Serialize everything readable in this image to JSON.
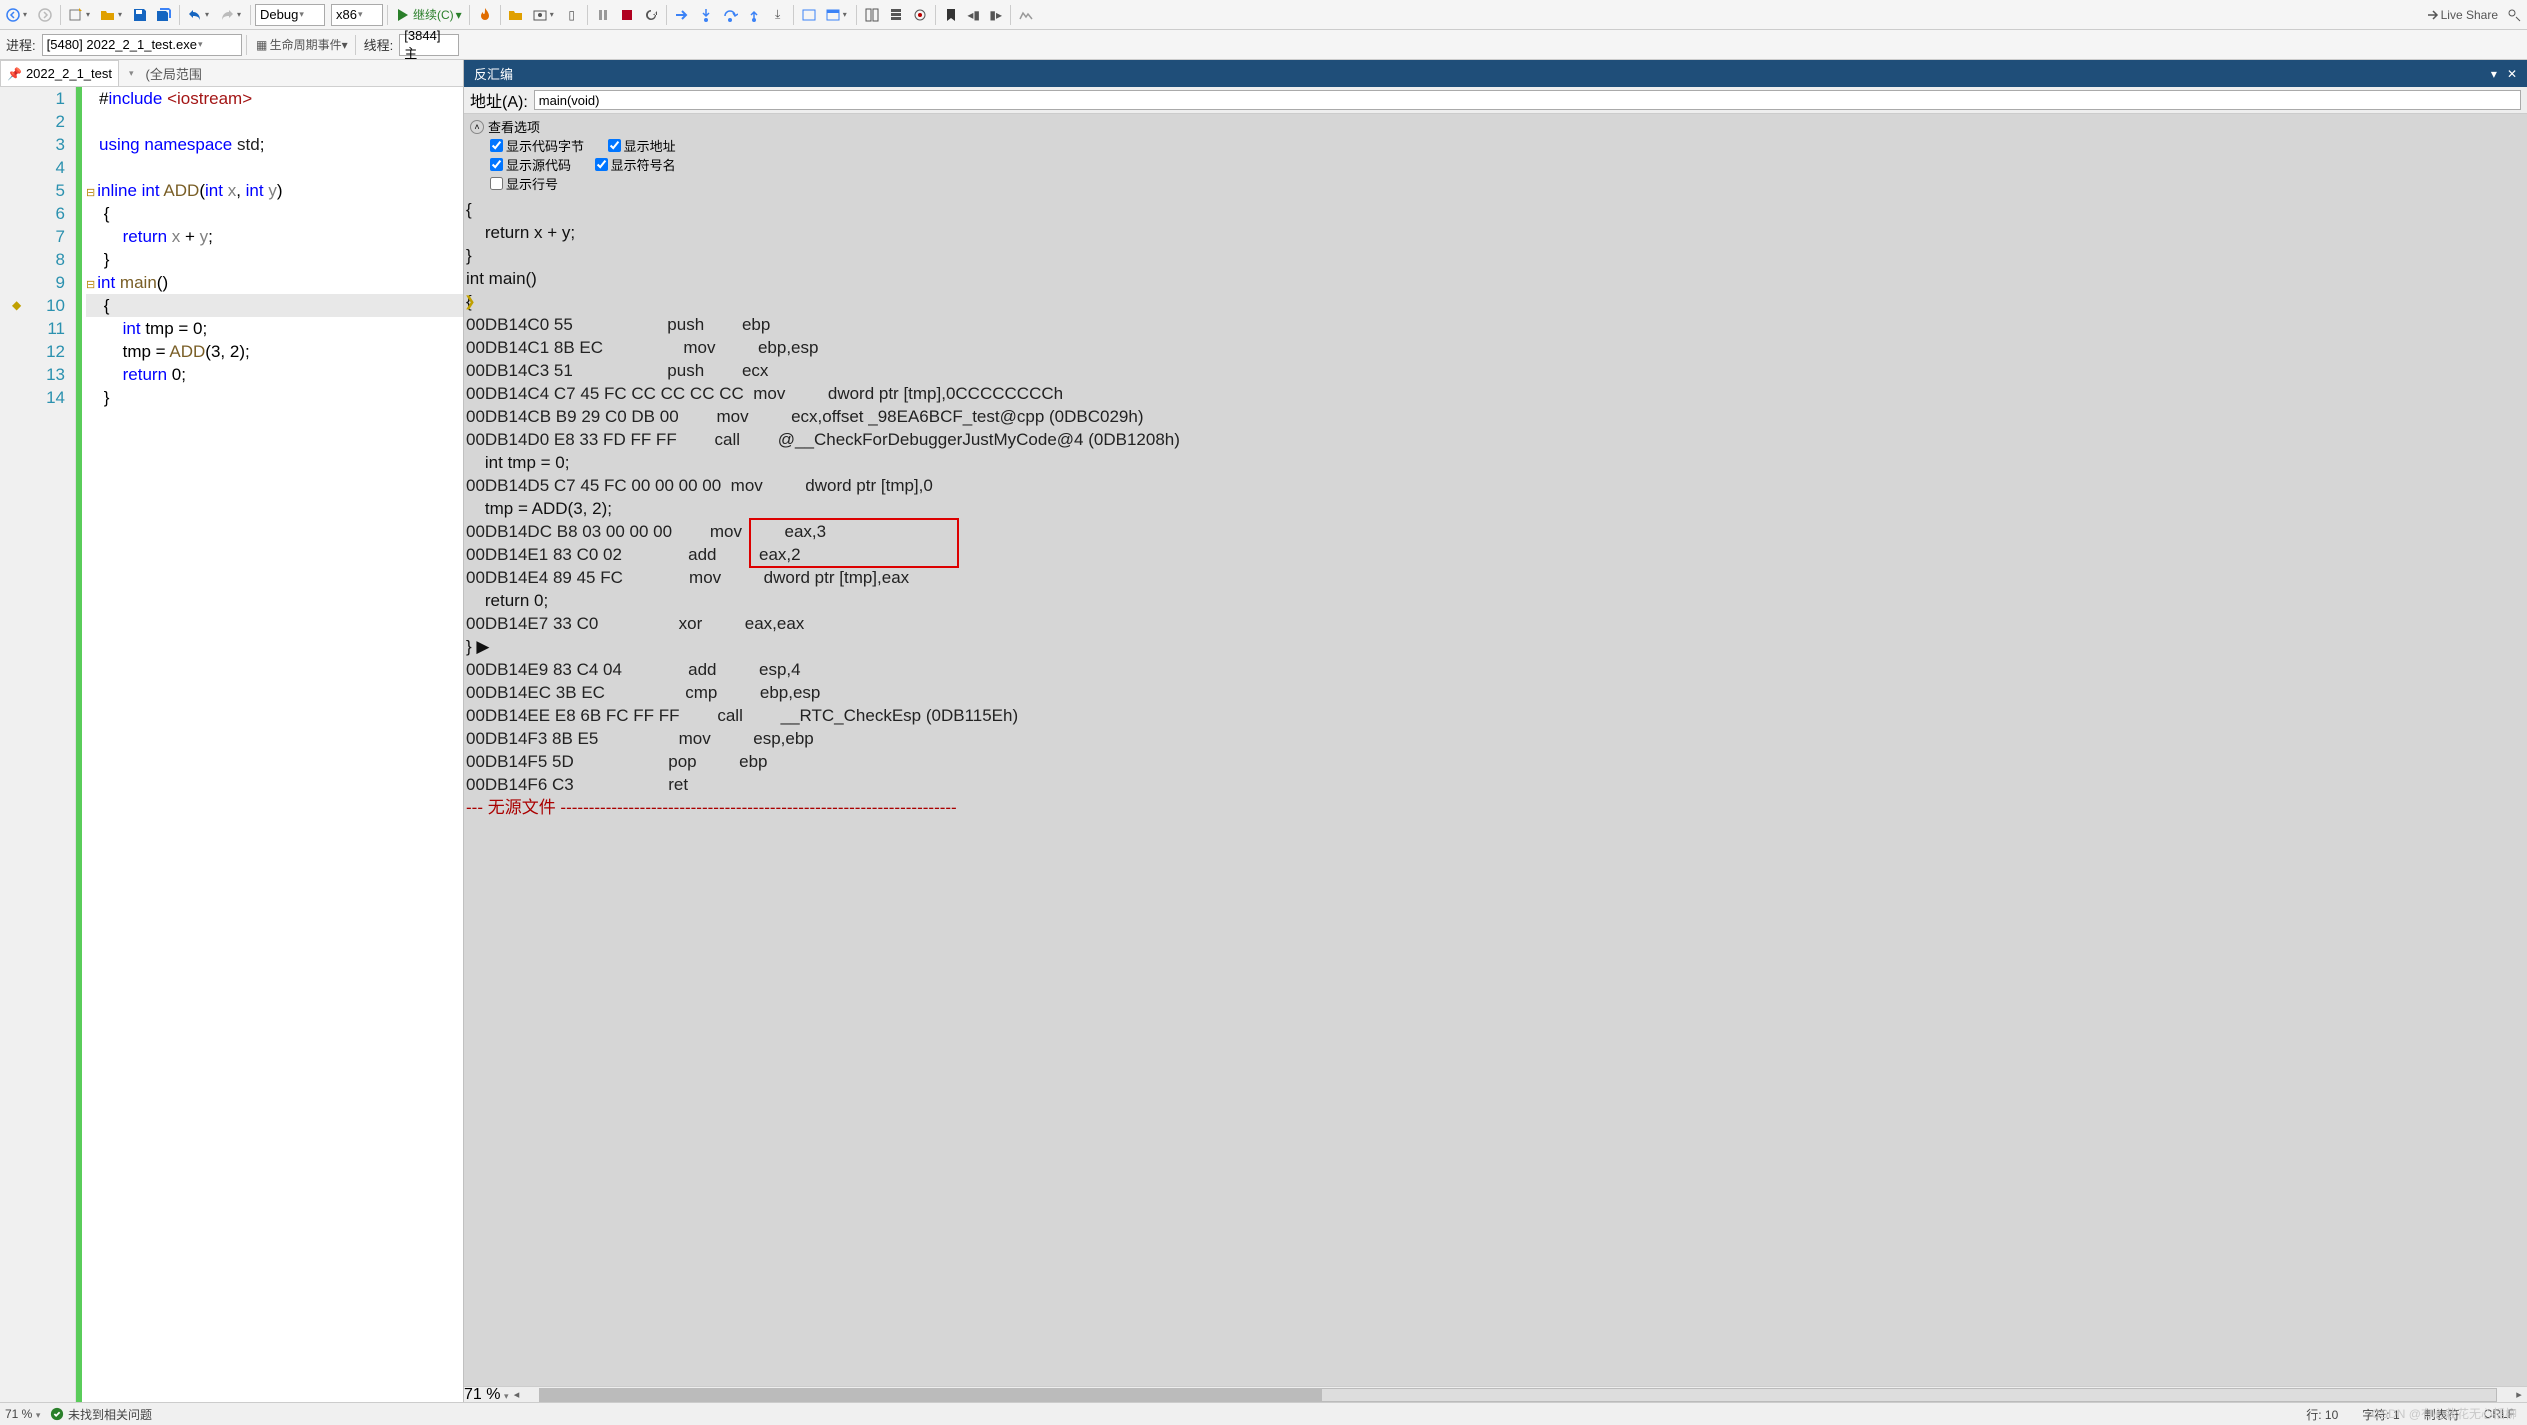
{
  "toolbar1": {
    "config": "Debug",
    "platform": "x86",
    "continue_label": "继续(C)",
    "live_share": "Live Share"
  },
  "toolbar2": {
    "process_label": "进程:",
    "process_value": "[5480] 2022_2_1_test.exe",
    "lifecycle_label": "生命周期事件",
    "thread_label": "线程:",
    "thread_value": "[3844] 主"
  },
  "left_pane": {
    "tab_name": "2022_2_1_test",
    "scope": "(全局范围",
    "lines": [
      "1",
      "2",
      "3",
      "4",
      "5",
      "6",
      "7",
      "8",
      "9",
      "10",
      "11",
      "12",
      "13",
      "14"
    ],
    "code": [
      {
        "html": "#<span class='t-kw'>include</span> <span class='t-inc'>&lt;iostream&gt;</span>",
        "o": ""
      },
      {
        "html": "",
        "o": ""
      },
      {
        "html": "<span class='t-kw'>using</span> <span class='t-kw'>namespace</span> <span class='t-id'>std</span>;",
        "o": ""
      },
      {
        "html": "",
        "o": ""
      },
      {
        "html": "<span class='t-kw'>inline</span> <span class='t-ty'>int</span> <span class='t-fn'>ADD</span>(<span class='t-ty'>int</span> <span class='t-pp'>x</span>, <span class='t-ty'>int</span> <span class='t-pp'>y</span>)",
        "o": "⊟"
      },
      {
        "html": " {",
        "o": ""
      },
      {
        "html": "     <span class='t-kw'>return</span> <span class='t-pp'>x</span> + <span class='t-pp'>y</span>;",
        "o": ""
      },
      {
        "html": " }",
        "o": ""
      },
      {
        "html": "<span class='t-ty'>int</span> <span class='t-fn'>main</span>()",
        "o": "⊟"
      },
      {
        "html": " {",
        "o": "",
        "hl": true,
        "bp": true
      },
      {
        "html": "     <span class='t-ty'>int</span> tmp = 0;",
        "o": ""
      },
      {
        "html": "     tmp = <span class='t-fn'>ADD</span>(3, 2);",
        "o": ""
      },
      {
        "html": "     <span class='t-kw'>return</span> 0;",
        "o": ""
      },
      {
        "html": " }",
        "o": ""
      }
    ]
  },
  "right_pane": {
    "title": "反汇编",
    "addr_label": "地址(A):",
    "addr_value": "main(void)",
    "view_options": "查看选项",
    "cb_code_bytes": "显示代码字节",
    "cb_show_addr": "显示地址",
    "cb_show_src": "显示源代码",
    "cb_symbol": "显示符号名",
    "cb_line_no": "显示行号",
    "rows": [
      {
        "t": "src",
        "s": "{"
      },
      {
        "t": "src",
        "s": "    return x + y;"
      },
      {
        "t": "src",
        "s": "}"
      },
      {
        "t": "src",
        "s": "int main()"
      },
      {
        "t": "src",
        "s": "{",
        "ptr": true
      },
      {
        "t": "asm",
        "a": "00DB14C0",
        "b": "55",
        "m": "push",
        "o": "ebp"
      },
      {
        "t": "asm",
        "a": "00DB14C1",
        "b": "8B EC",
        "m": "mov",
        "o": "ebp,esp"
      },
      {
        "t": "asm",
        "a": "00DB14C3",
        "b": "51",
        "m": "push",
        "o": "ecx"
      },
      {
        "t": "asm",
        "a": "00DB14C4",
        "b": "C7 45 FC CC CC CC CC",
        "m": "mov",
        "o": "dword ptr [tmp],0CCCCCCCCh"
      },
      {
        "t": "asm",
        "a": "00DB14CB",
        "b": "B9 29 C0 DB 00",
        "m": "mov",
        "o": "ecx,offset _98EA6BCF_test@cpp (0DBC029h)"
      },
      {
        "t": "asm",
        "a": "00DB14D0",
        "b": "E8 33 FD FF FF",
        "m": "call",
        "o": "@__CheckForDebuggerJustMyCode@4 (0DB1208h)"
      },
      {
        "t": "src",
        "s": "    int tmp = 0;"
      },
      {
        "t": "asm",
        "a": "00DB14D5",
        "b": "C7 45 FC 00 00 00 00",
        "m": "mov",
        "o": "dword ptr [tmp],0"
      },
      {
        "t": "src",
        "s": "    tmp = ADD(3, 2);"
      },
      {
        "t": "asm",
        "a": "00DB14DC",
        "b": "B8 03 00 00 00",
        "m": "mov",
        "o": "eax,3"
      },
      {
        "t": "asm",
        "a": "00DB14E1",
        "b": "83 C0 02",
        "m": "add",
        "o": "eax,2"
      },
      {
        "t": "asm",
        "a": "00DB14E4",
        "b": "89 45 FC",
        "m": "mov",
        "o": "dword ptr [tmp],eax"
      },
      {
        "t": "src",
        "s": "    return 0;"
      },
      {
        "t": "asm",
        "a": "00DB14E7",
        "b": "33 C0",
        "m": "xor",
        "o": "eax,eax"
      },
      {
        "t": "src",
        "s": "} ▶"
      },
      {
        "t": "asm",
        "a": "00DB14E9",
        "b": "83 C4 04",
        "m": "add",
        "o": "esp,4"
      },
      {
        "t": "asm",
        "a": "00DB14EC",
        "b": "3B EC",
        "m": "cmp",
        "o": "ebp,esp"
      },
      {
        "t": "asm",
        "a": "00DB14EE",
        "b": "E8 6B FC FF FF",
        "m": "call",
        "o": "__RTC_CheckEsp (0DB115Eh)"
      },
      {
        "t": "asm",
        "a": "00DB14F3",
        "b": "8B E5",
        "m": "mov",
        "o": "esp,ebp"
      },
      {
        "t": "asm",
        "a": "00DB14F5",
        "b": "5D",
        "m": "pop",
        "o": "ebp"
      },
      {
        "t": "asm",
        "a": "00DB14F6",
        "b": "C3",
        "m": "ret",
        "o": ""
      },
      {
        "t": "sep",
        "s": "--- 无源文件 ----------------------------------------------------------------------"
      }
    ],
    "redbox": {
      "row_start": 14,
      "row_end": 15
    }
  },
  "status": {
    "zoom_left": "71 %",
    "zoom_right": "71 %",
    "issues": "未找到相关问题",
    "line": "行: 10",
    "char": "字符: 1",
    "tabs": "制表符",
    "crlf": "CRLF",
    "watermark": "CSDN @有心栽花无心插柳"
  }
}
